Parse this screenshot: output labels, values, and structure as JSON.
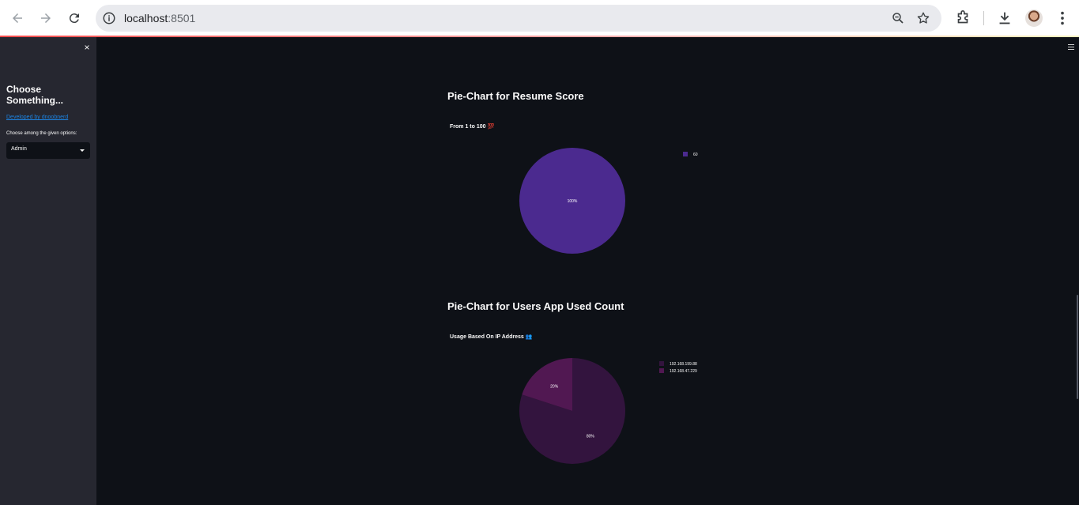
{
  "browser": {
    "url_host": "localhost",
    "url_port": ":8501"
  },
  "sidebar": {
    "close_label": "×",
    "title": "Choose Something...",
    "link_text": "Developed by dnoobnerd",
    "select_label": "Choose among the given options:",
    "select_value": "Admin"
  },
  "charts": [
    {
      "heading": "Pie-Chart for Resume Score",
      "subtitle": "From 1 to 100",
      "subtitle_emoji": "💯"
    },
    {
      "heading": "Pie-Chart for Users App Used Count",
      "subtitle": "Usage Based On IP Address",
      "subtitle_emoji": "👥"
    }
  ],
  "chart_data": [
    {
      "type": "pie",
      "title": "From 1 to 100",
      "labels": [
        "60"
      ],
      "values": [
        100
      ],
      "slice_labels": [
        "100%"
      ],
      "colors": [
        "#4b2a8f"
      ],
      "legend_placement": "top-right"
    },
    {
      "type": "pie",
      "title": "Usage Based On IP Address",
      "labels": [
        "192.168.199.88",
        "192.168.47.229"
      ],
      "values": [
        80,
        20
      ],
      "slice_labels": [
        "80%",
        "20%"
      ],
      "colors": [
        "#33143e",
        "#511852"
      ],
      "legend_placement": "top-right"
    }
  ],
  "colors": {
    "app_background": "#0e1117",
    "sidebar_background": "#262730",
    "link": "#1c83e1"
  }
}
